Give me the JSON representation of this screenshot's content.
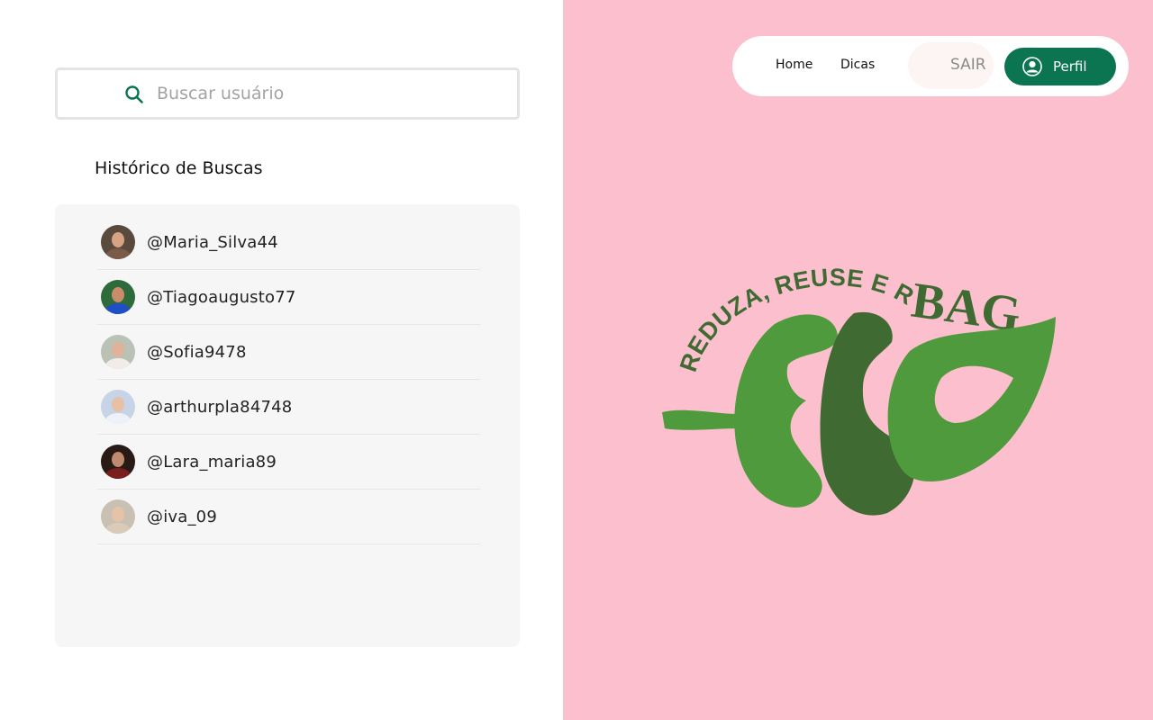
{
  "search": {
    "placeholder": "Buscar usuário",
    "value": ""
  },
  "history": {
    "title": "Histórico de Buscas",
    "items": [
      {
        "username": "@Maria_Silva44"
      },
      {
        "username": "@Tiagoaugusto77"
      },
      {
        "username": "@Sofia9478"
      },
      {
        "username": "@arthurpla84748"
      },
      {
        "username": "@Lara_maria89"
      },
      {
        "username": "@iva_09"
      }
    ]
  },
  "nav": {
    "home": "Home",
    "dicas": "Dicas",
    "sair": "SAIR",
    "perfil": "Perfil"
  },
  "logo": {
    "slogan": "REDUZA, REUSE E RECICLE",
    "brand_top": "BAG",
    "brand_main": "ECO"
  },
  "colors": {
    "accent": "#0b7450",
    "right_bg": "#fcbfce",
    "logo_light": "#4e9a3d",
    "logo_dark": "#3f6a32"
  },
  "icons": {
    "search": "search-icon",
    "user": "user-icon"
  }
}
